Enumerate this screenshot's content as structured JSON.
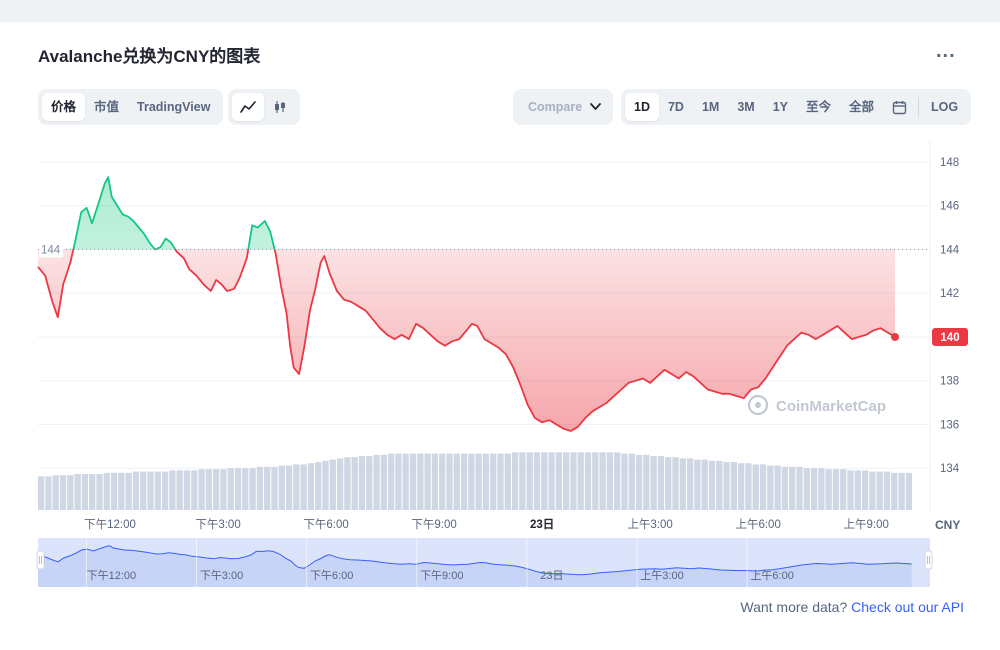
{
  "title": "Avalanche兑换为CNY的图表",
  "more_label": "...",
  "view_tabs": [
    {
      "label": "价格",
      "active": true
    },
    {
      "label": "市值",
      "active": false
    },
    {
      "label": "TradingView",
      "active": false
    }
  ],
  "chart_style_icons": [
    {
      "name": "line-chart-icon",
      "active": true
    },
    {
      "name": "candlestick-icon",
      "active": false
    }
  ],
  "compare_label": "Compare",
  "range_tabs": [
    {
      "label": "1D",
      "active": true
    },
    {
      "label": "7D",
      "active": false
    },
    {
      "label": "1M",
      "active": false
    },
    {
      "label": "3M",
      "active": false
    },
    {
      "label": "1Y",
      "active": false
    },
    {
      "label": "至今",
      "active": false
    },
    {
      "label": "全部",
      "active": false
    }
  ],
  "calendar_icon": "calendar-icon",
  "log_label": "LOG",
  "watermark": "CoinMarketCap",
  "api_text": "Want more data?",
  "api_link": "Check out our API",
  "colors": {
    "up": "#16c784",
    "down": "#ea3943",
    "accent": "#3861fb",
    "volume": "#cfd6e4",
    "navigator": "#dce4fb"
  },
  "chart_data": {
    "type": "line",
    "unit": "CNY",
    "open_price": 144,
    "current_price": 140,
    "open_price_label": "144",
    "current_price_label": "140",
    "ylim": [
      132,
      149
    ],
    "y_ticks": [
      "148",
      "146",
      "144",
      "142",
      "140",
      "138",
      "136",
      "134"
    ],
    "y_tick_values": [
      148,
      146,
      144,
      142,
      140,
      138,
      136,
      134
    ],
    "x_range_hours": [
      10.0,
      34.3
    ],
    "x_ticks": [
      {
        "label": "下午12:00",
        "hour": 12,
        "bold": false
      },
      {
        "label": "下午3:00",
        "hour": 15,
        "bold": false
      },
      {
        "label": "下午6:00",
        "hour": 18,
        "bold": false
      },
      {
        "label": "下午9:00",
        "hour": 21,
        "bold": false
      },
      {
        "label": "23日",
        "hour": 24,
        "bold": true
      },
      {
        "label": "上午3:00",
        "hour": 27,
        "bold": false
      },
      {
        "label": "上午6:00",
        "hour": 30,
        "bold": false
      },
      {
        "label": "上午9:00",
        "hour": 33,
        "bold": false
      }
    ],
    "navigator_ticks": [
      {
        "label": "下午12:00",
        "hour": 12
      },
      {
        "label": "下午3:00",
        "hour": 15
      },
      {
        "label": "下午6:00",
        "hour": 18
      },
      {
        "label": "下午9:00",
        "hour": 21
      },
      {
        "label": "23日",
        "hour": 24
      },
      {
        "label": "上午3:00",
        "hour": 27
      },
      {
        "label": "上午6:00",
        "hour": 30
      }
    ],
    "series": [
      {
        "points": [
          [
            10.0,
            143.2
          ],
          [
            10.2,
            142.8
          ],
          [
            10.4,
            141.6
          ],
          [
            10.55,
            140.9
          ],
          [
            10.7,
            142.4
          ],
          [
            10.9,
            143.4
          ],
          [
            11.05,
            144.5
          ],
          [
            11.2,
            145.7
          ],
          [
            11.35,
            145.9
          ],
          [
            11.5,
            145.2
          ],
          [
            11.7,
            146.2
          ],
          [
            11.85,
            147.0
          ],
          [
            11.95,
            147.3
          ],
          [
            12.05,
            146.4
          ],
          [
            12.2,
            146.0
          ],
          [
            12.35,
            145.6
          ],
          [
            12.5,
            145.5
          ],
          [
            12.65,
            145.3
          ],
          [
            12.8,
            145.0
          ],
          [
            12.95,
            144.7
          ],
          [
            13.1,
            144.3
          ],
          [
            13.25,
            144.0
          ],
          [
            13.4,
            144.1
          ],
          [
            13.55,
            144.5
          ],
          [
            13.7,
            144.3
          ],
          [
            13.85,
            143.9
          ],
          [
            14.05,
            143.6
          ],
          [
            14.2,
            143.1
          ],
          [
            14.4,
            142.8
          ],
          [
            14.6,
            142.4
          ],
          [
            14.8,
            142.1
          ],
          [
            14.95,
            142.6
          ],
          [
            15.1,
            142.4
          ],
          [
            15.25,
            142.1
          ],
          [
            15.45,
            142.2
          ],
          [
            15.6,
            142.7
          ],
          [
            15.8,
            143.6
          ],
          [
            15.95,
            145.1
          ],
          [
            16.1,
            145.0
          ],
          [
            16.3,
            145.3
          ],
          [
            16.45,
            144.8
          ],
          [
            16.6,
            143.8
          ],
          [
            16.75,
            142.3
          ],
          [
            16.9,
            141.1
          ],
          [
            17.0,
            139.6
          ],
          [
            17.1,
            138.6
          ],
          [
            17.25,
            138.3
          ],
          [
            17.4,
            139.6
          ],
          [
            17.55,
            141.2
          ],
          [
            17.7,
            142.2
          ],
          [
            17.85,
            143.4
          ],
          [
            17.95,
            143.7
          ],
          [
            18.1,
            142.9
          ],
          [
            18.3,
            142.1
          ],
          [
            18.5,
            141.7
          ],
          [
            18.7,
            141.6
          ],
          [
            18.9,
            141.4
          ],
          [
            19.1,
            141.2
          ],
          [
            19.3,
            140.8
          ],
          [
            19.5,
            140.4
          ],
          [
            19.7,
            140.1
          ],
          [
            19.9,
            139.9
          ],
          [
            20.1,
            140.1
          ],
          [
            20.3,
            139.9
          ],
          [
            20.5,
            140.6
          ],
          [
            20.7,
            140.4
          ],
          [
            20.9,
            140.1
          ],
          [
            21.1,
            139.8
          ],
          [
            21.3,
            139.6
          ],
          [
            21.5,
            139.8
          ],
          [
            21.7,
            139.9
          ],
          [
            21.9,
            140.3
          ],
          [
            22.05,
            140.6
          ],
          [
            22.2,
            140.5
          ],
          [
            22.4,
            139.9
          ],
          [
            22.6,
            139.7
          ],
          [
            22.8,
            139.5
          ],
          [
            23.0,
            139.2
          ],
          [
            23.2,
            138.6
          ],
          [
            23.4,
            137.8
          ],
          [
            23.6,
            136.9
          ],
          [
            23.8,
            136.3
          ],
          [
            24.0,
            136.1
          ],
          [
            24.2,
            136.2
          ],
          [
            24.4,
            136.0
          ],
          [
            24.6,
            135.8
          ],
          [
            24.8,
            135.7
          ],
          [
            25.0,
            135.9
          ],
          [
            25.2,
            136.3
          ],
          [
            25.4,
            136.6
          ],
          [
            25.6,
            136.8
          ],
          [
            25.8,
            137.0
          ],
          [
            26.0,
            137.3
          ],
          [
            26.2,
            137.6
          ],
          [
            26.4,
            137.9
          ],
          [
            26.6,
            138.0
          ],
          [
            26.8,
            138.1
          ],
          [
            27.0,
            137.9
          ],
          [
            27.2,
            138.2
          ],
          [
            27.4,
            138.5
          ],
          [
            27.6,
            138.3
          ],
          [
            27.8,
            138.1
          ],
          [
            28.0,
            138.4
          ],
          [
            28.2,
            138.2
          ],
          [
            28.4,
            137.9
          ],
          [
            28.6,
            137.6
          ],
          [
            28.8,
            137.5
          ],
          [
            29.0,
            137.4
          ],
          [
            29.2,
            137.4
          ],
          [
            29.4,
            137.3
          ],
          [
            29.6,
            137.2
          ],
          [
            29.8,
            137.6
          ],
          [
            30.0,
            137.7
          ],
          [
            30.2,
            138.1
          ],
          [
            30.4,
            138.6
          ],
          [
            30.6,
            139.1
          ],
          [
            30.8,
            139.6
          ],
          [
            31.0,
            139.9
          ],
          [
            31.2,
            140.2
          ],
          [
            31.4,
            140.1
          ],
          [
            31.6,
            139.9
          ],
          [
            31.8,
            140.1
          ],
          [
            32.0,
            140.3
          ],
          [
            32.2,
            140.5
          ],
          [
            32.4,
            140.2
          ],
          [
            32.6,
            139.9
          ],
          [
            32.8,
            140.0
          ],
          [
            33.0,
            140.1
          ],
          [
            33.2,
            140.3
          ],
          [
            33.4,
            140.4
          ],
          [
            33.6,
            140.2
          ],
          [
            33.8,
            140.0
          ]
        ]
      }
    ],
    "volume": [
      0.28,
      0.28,
      0.29,
      0.29,
      0.29,
      0.3,
      0.3,
      0.3,
      0.3,
      0.31,
      0.31,
      0.31,
      0.31,
      0.32,
      0.32,
      0.32,
      0.32,
      0.32,
      0.33,
      0.33,
      0.33,
      0.33,
      0.34,
      0.34,
      0.34,
      0.34,
      0.35,
      0.35,
      0.35,
      0.35,
      0.36,
      0.36,
      0.36,
      0.37,
      0.37,
      0.38,
      0.38,
      0.39,
      0.4,
      0.41,
      0.42,
      0.43,
      0.44,
      0.44,
      0.45,
      0.45,
      0.46,
      0.46,
      0.47,
      0.47,
      0.47,
      0.47,
      0.47,
      0.47,
      0.47,
      0.47,
      0.47,
      0.47,
      0.47,
      0.47,
      0.47,
      0.47,
      0.47,
      0.47,
      0.47,
      0.48,
      0.48,
      0.48,
      0.48,
      0.48,
      0.48,
      0.48,
      0.48,
      0.48,
      0.48,
      0.48,
      0.48,
      0.48,
      0.48,
      0.48,
      0.47,
      0.47,
      0.46,
      0.46,
      0.45,
      0.45,
      0.44,
      0.44,
      0.43,
      0.43,
      0.42,
      0.42,
      0.41,
      0.41,
      0.4,
      0.4,
      0.39,
      0.39,
      0.38,
      0.38,
      0.37,
      0.37,
      0.36,
      0.36,
      0.36,
      0.35,
      0.35,
      0.35,
      0.34,
      0.34,
      0.34,
      0.33,
      0.33,
      0.33,
      0.32,
      0.32,
      0.32,
      0.31,
      0.31,
      0.31
    ]
  }
}
